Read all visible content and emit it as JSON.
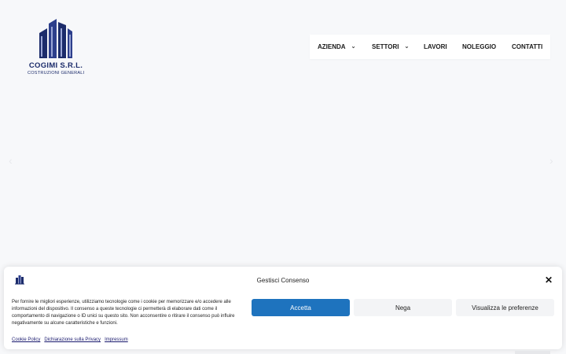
{
  "logo": {
    "name": "COGIMI S.R.L.",
    "subtitle": "COSTRUZIONI GENERALI"
  },
  "nav": {
    "items": [
      {
        "label": "AZIENDA",
        "has_dropdown": true
      },
      {
        "label": "SETTORI",
        "has_dropdown": true
      },
      {
        "label": "LAVORI",
        "has_dropdown": false
      },
      {
        "label": "NOLEGGIO",
        "has_dropdown": false
      },
      {
        "label": "CONTATTI",
        "has_dropdown": false
      }
    ]
  },
  "slider": {
    "prev_icon": "chevron-left-icon",
    "next_icon": "chevron-right-icon"
  },
  "consent": {
    "title": "Gestisci Consenso",
    "text": "Per fornire le migliori esperienze, utilizziamo tecnologie come i cookie per memorizzare e/o accedere alle informazioni del dispositivo. Il consenso a queste tecnologie ci permetterà di elaborare dati come il comportamento di navigazione o ID unici su questo sito. Non acconsentire o ritirare il consenso può influire negativamente su alcune caratteristiche e funzioni.",
    "accept_label": "Accetta",
    "deny_label": "Nega",
    "preferences_label": "Visualizza le preferenze",
    "links": [
      "Cookie Policy",
      "Dichiarazione sulla Privacy",
      "Impressum"
    ]
  },
  "colors": {
    "brand_navy": "#1c2c6b",
    "accept_blue": "#1e73be"
  }
}
